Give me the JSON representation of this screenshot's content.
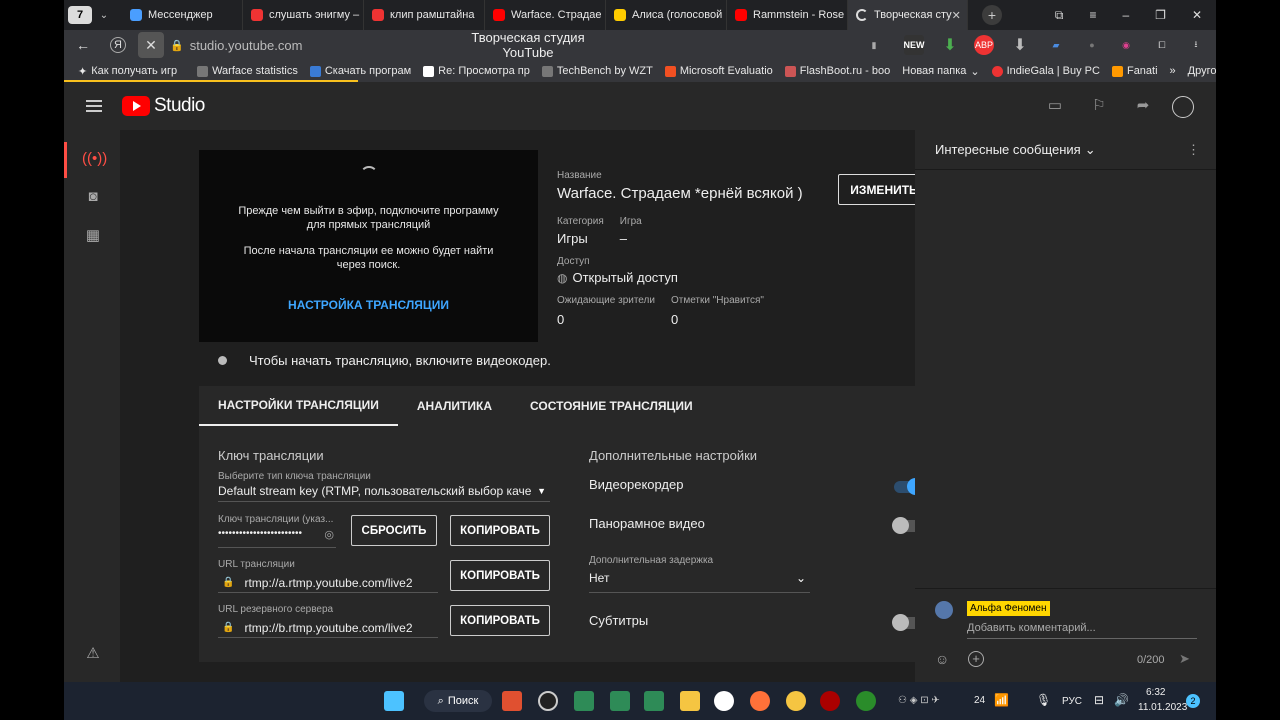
{
  "browser": {
    "tab_count": "7",
    "tabs": [
      {
        "title": "Мессенджер",
        "color": "#4a9eff"
      },
      {
        "title": "слушать энигму –",
        "color": "#ff3333"
      },
      {
        "title": "клип рамштайна",
        "color": "#ff3333"
      },
      {
        "title": "Warface. Страдае",
        "color": "#ff0000"
      },
      {
        "title": "Алиса (голосовой",
        "color": "#ffcc00"
      },
      {
        "title": "Rammstein - Rose",
        "color": "#ff0000"
      },
      {
        "title": "Творческая сту",
        "color": "#ffffff"
      }
    ],
    "url": "studio.youtube.com",
    "page_title": "Творческая студия YouTube",
    "bookmarks": [
      "Как получать игр",
      "Warface statistics",
      "Скачать програм",
      "Re: Просмотра пр",
      "TechBench by WZT",
      "Microsoft Evaluatio",
      "FlashBoot.ru - boo",
      "Новая папка",
      "IndieGala | Buy PC",
      "Fanati",
      "Другое"
    ]
  },
  "studio": {
    "logo_text": "Studio"
  },
  "preview": {
    "message1": "Прежде чем выйти в эфир, подключите программу для прямых трансляций",
    "message2": "После начала трансляции ее можно будет найти через поиск.",
    "setup_link": "НАСТРОЙКА ТРАНСЛЯЦИИ"
  },
  "stream_info": {
    "title_label": "Название",
    "title": "Warface. Страдаем *ернёй всякой )",
    "edit_button": "ИЗМЕНИТЬ",
    "category_label": "Категория",
    "category": "Игры",
    "game_label": "Игра",
    "game": "–",
    "access_label": "Доступ",
    "access": "Открытый доступ",
    "viewers_label": "Ожидающие зрители",
    "viewers": "0",
    "likes_label": "Отметки \"Нравится\"",
    "likes": "0"
  },
  "status": "Чтобы начать трансляцию, включите видеокодер.",
  "tabs": [
    "НАСТРОЙКИ ТРАНСЛЯЦИИ",
    "АНАЛИТИКА",
    "СОСТОЯНИЕ ТРАНСЛЯЦИИ"
  ],
  "key_section": {
    "title": "Ключ трансляции",
    "key_type_label": "Выберите тип ключа трансляции",
    "key_type": "Default stream key (RTMP, пользовательский выбор каче",
    "key_label": "Ключ трансляции (указ...",
    "key_value": "••••••••••••••••••••••••",
    "reset_button": "СБРОСИТЬ",
    "copy_button": "КОПИРОВАТЬ",
    "url_label": "URL трансляции",
    "url_value": "rtmp://a.rtmp.youtube.com/live2",
    "backup_label": "URL резервного сервера",
    "backup_value": "rtmp://b.rtmp.youtube.com/live2"
  },
  "extra": {
    "title": "Дополнительные настройки",
    "dvr_label": "Видеорекордер",
    "dvr_on": true,
    "pano_label": "Панорамное видео",
    "pano_on": false,
    "latency_label": "Дополнительная задержка",
    "latency_value": "Нет",
    "subs_label": "Субтитры",
    "subs_on": false
  },
  "chat": {
    "header": "Интересные сообщения",
    "author": "Альфа Феномен",
    "placeholder": "Добавить комментарий...",
    "counter": "0/200"
  },
  "taskbar": {
    "search": "Поиск",
    "lang": "РУС",
    "time": "6:32",
    "date": "11.01.2023",
    "notif_count": "2",
    "tray_num": "24"
  },
  "colors": {
    "accent": "#3ea6ff",
    "youtube_red": "#ff0000",
    "chip": "#ffd600"
  }
}
